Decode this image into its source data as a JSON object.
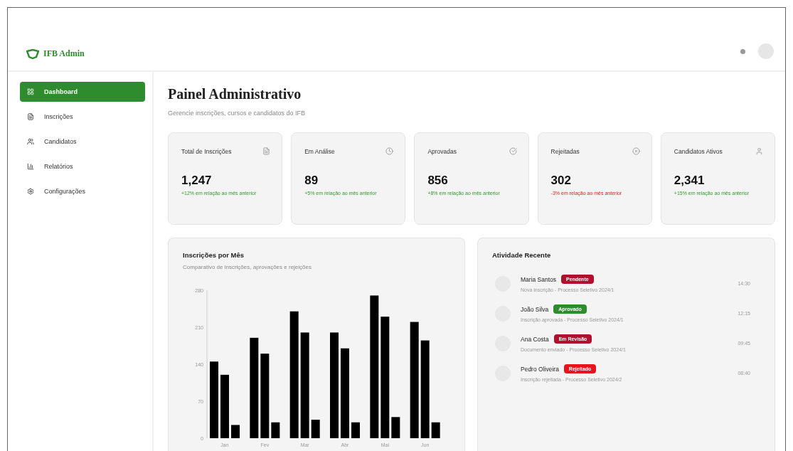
{
  "header": {
    "brand": "IFB Admin"
  },
  "sidebar": {
    "items": [
      {
        "label": "Dashboard",
        "selected": true
      },
      {
        "label": "Inscrições",
        "selected": false
      },
      {
        "label": "Candidatos",
        "selected": false
      },
      {
        "label": "Relatórios",
        "selected": false
      },
      {
        "label": "Configurações",
        "selected": false
      }
    ]
  },
  "page": {
    "title": "Painel Administrativo",
    "subtitle": "Gerencie inscrições, cursos e candidatos do IFB"
  },
  "stats": [
    {
      "label": "Total de Inscrições",
      "value": "1,247",
      "change": "+12% em relação ao mês anterior",
      "negative": false
    },
    {
      "label": "Em Análise",
      "value": "89",
      "change": "+5% em relação ao mês anterior",
      "negative": false
    },
    {
      "label": "Aprovadas",
      "value": "856",
      "change": "+8% em relação ao mês anterior",
      "negative": false
    },
    {
      "label": "Rejeitadas",
      "value": "302",
      "change": "-3% em relação ao mês anterior",
      "negative": true
    },
    {
      "label": "Candidatos Ativos",
      "value": "2,341",
      "change": "+15% em relação ao mês anterior",
      "negative": false
    }
  ],
  "chart_panel": {
    "title": "Inscrições por Mês",
    "subtitle": "Comparativo de inscrições, aprovações e rejeições",
    "chart_data": {
      "type": "bar",
      "categories": [
        "Jan",
        "Fev",
        "Mar",
        "Abr",
        "Mai",
        "Jun"
      ],
      "series": [
        {
          "color": "#000000",
          "values": [
            145,
            190,
            240,
            200,
            270,
            220
          ]
        },
        {
          "color": "#000000",
          "values": [
            120,
            160,
            200,
            170,
            230,
            185
          ]
        },
        {
          "color": "#000000",
          "values": [
            25,
            30,
            35,
            30,
            40,
            30
          ]
        }
      ],
      "ylim": [
        0,
        280
      ],
      "yticks": [
        0,
        70,
        140,
        210,
        280
      ]
    }
  },
  "activity": {
    "title": "Atividade Recente",
    "items": [
      {
        "name": "Maria Santos",
        "status": "Pendente",
        "color": "#b0102e",
        "description": "Nova inscrição - Processo Seletivo 2024/1",
        "time": "14:30"
      },
      {
        "name": "João Silva",
        "status": "Aprovado",
        "color": "#2e8b2e",
        "description": "Inscrição aprovada - Processo Seletivo 2024/1",
        "time": "12:15"
      },
      {
        "name": "Ana Costa",
        "status": "Em Revisão",
        "color": "#b0102e",
        "description": "Documento enviado - Processo Seletivo 2024/1",
        "time": "09:45"
      },
      {
        "name": "Pedro Oliveira",
        "status": "Rejeitado",
        "color": "#e8141c",
        "description": "Inscrição rejeitada - Processo Seletivo 2024/2",
        "time": "08:40"
      }
    ]
  }
}
